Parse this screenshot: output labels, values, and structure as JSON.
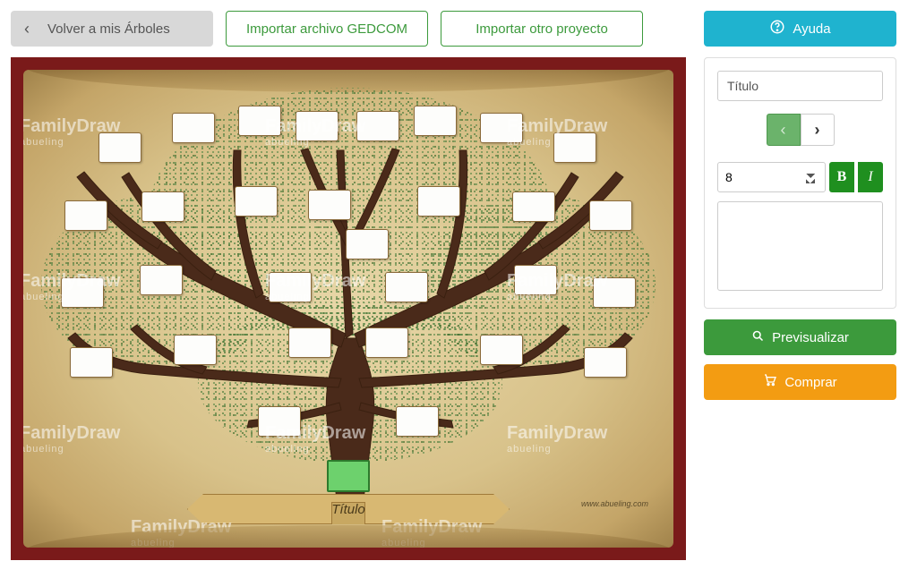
{
  "top": {
    "back_label": "Volver a mis Árboles",
    "import_gedcom_label": "Importar archivo GEDCOM",
    "import_project_label": "Importar otro proyecto"
  },
  "right": {
    "help_label": "Ayuda",
    "title_placeholder": "Título",
    "title_value": "Título",
    "font_size_value": "8",
    "bold_label": "B",
    "italic_label": "I",
    "preview_label": " Previsualizar",
    "buy_label": " Comprar"
  },
  "canvas": {
    "title_banner": "Título",
    "watermark_main": "FamilyDraw",
    "watermark_sub": "abueling",
    "site_url": "www.abueling.com"
  },
  "icons": {
    "help": "help-circle-icon",
    "search": "search-icon",
    "cart": "cart-icon",
    "chevron_left": "chevron-left-icon",
    "chevron_right": "chevron-right-icon"
  }
}
